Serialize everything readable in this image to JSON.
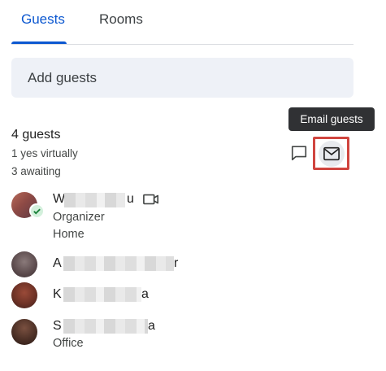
{
  "tabs": [
    {
      "label": "Guests",
      "active": true
    },
    {
      "label": "Rooms",
      "active": false
    }
  ],
  "add_guests": {
    "placeholder": "Add guests"
  },
  "summary": {
    "count": "4 guests",
    "yes_virtually": "1 yes virtually",
    "awaiting": "3 awaiting"
  },
  "actions": {
    "tooltip": "Email guests",
    "chat_icon": "chat-bubble-icon",
    "email_icon": "envelope-icon"
  },
  "guests": [
    {
      "first": "W",
      "last": "u",
      "role": "Organizer",
      "location": "Home",
      "status": "accepted",
      "attendance_icon": "video-camera-icon"
    },
    {
      "first": "A",
      "last": "r",
      "role": "",
      "location": "",
      "status": "awaiting"
    },
    {
      "first": "K",
      "last": "a",
      "role": "",
      "location": "",
      "status": "awaiting"
    },
    {
      "first": "S",
      "last": "a",
      "role": "",
      "location": "Office",
      "status": "awaiting"
    }
  ],
  "colors": {
    "accent": "#0b57d0",
    "highlight_border": "#d0453f",
    "input_bg": "#eef1f7",
    "tooltip_bg": "#303134",
    "accepted_green": "#188038"
  }
}
